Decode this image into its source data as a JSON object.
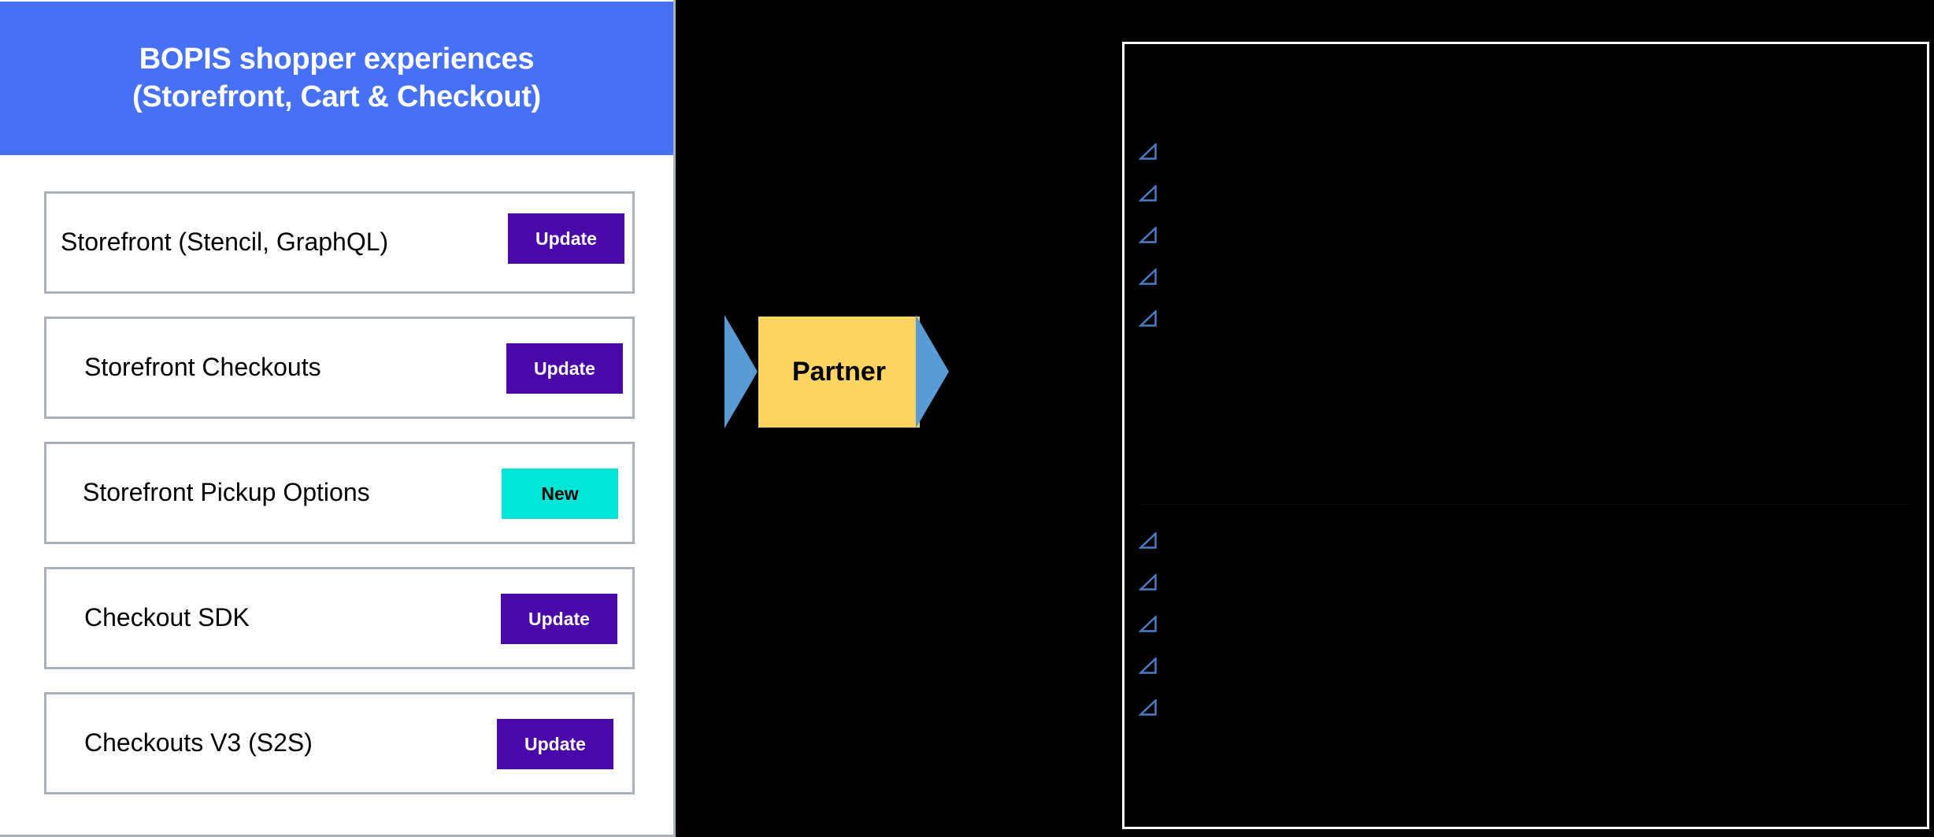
{
  "left_panel": {
    "header": {
      "title": "BOPIS shopper experiences\n(Storefront, Cart & Checkout)",
      "background_color": "#4671F7",
      "text_color": "#FFFFFF"
    },
    "cards": [
      {
        "label": "Storefront (Stencil, GraphQL)",
        "badge_label": "Update",
        "badge_color": "#4A08A8",
        "badge_text_color": "#FFFFFF"
      },
      {
        "label": "Storefront Checkouts",
        "badge_label": "Update",
        "badge_color": "#4A08A8",
        "badge_text_color": "#FFFFFF"
      },
      {
        "label": "Storefront Pickup Options",
        "badge_label": "New",
        "badge_color": "#00E5D8",
        "badge_text_color": "#000000"
      },
      {
        "label": "Checkout SDK",
        "badge_label": "Update",
        "badge_color": "#4A08A8",
        "badge_text_color": "#FFFFFF"
      },
      {
        "label": "Checkouts V3 (S2S)",
        "badge_label": "Update",
        "badge_color": "#4A08A8",
        "badge_text_color": "#FFFFFF"
      }
    ],
    "card_border_color": "#A9B0BC"
  },
  "middle_band": {
    "background_color": "#000000",
    "arrow_color": "#5B9BD5",
    "partner_box": {
      "label": "Partner",
      "background_color": "#FCD462",
      "text_color": "#000000"
    },
    "left_arrow_name": "flow-arrow-left",
    "right_arrow_name": "flow-arrow-right"
  },
  "right_panel": {
    "background_color": "#000000",
    "border_color": "#FFFFFF",
    "icon_color": "#4A7EC8",
    "title": "",
    "groups": [
      {
        "name": "checklist-group-top",
        "items": [
          {
            "icon": "triangle-outline-icon",
            "text": ""
          },
          {
            "icon": "triangle-outline-icon",
            "text": ""
          },
          {
            "icon": "triangle-outline-icon",
            "text": ""
          },
          {
            "icon": "triangle-outline-icon",
            "text": ""
          },
          {
            "icon": "triangle-outline-icon",
            "text": ""
          }
        ]
      },
      {
        "name": "checklist-group-bottom",
        "items": [
          {
            "icon": "triangle-outline-icon",
            "text": ""
          },
          {
            "icon": "triangle-outline-icon",
            "text": ""
          },
          {
            "icon": "triangle-outline-icon",
            "text": ""
          },
          {
            "icon": "triangle-outline-icon",
            "text": ""
          },
          {
            "icon": "triangle-outline-icon",
            "text": ""
          }
        ]
      }
    ]
  }
}
